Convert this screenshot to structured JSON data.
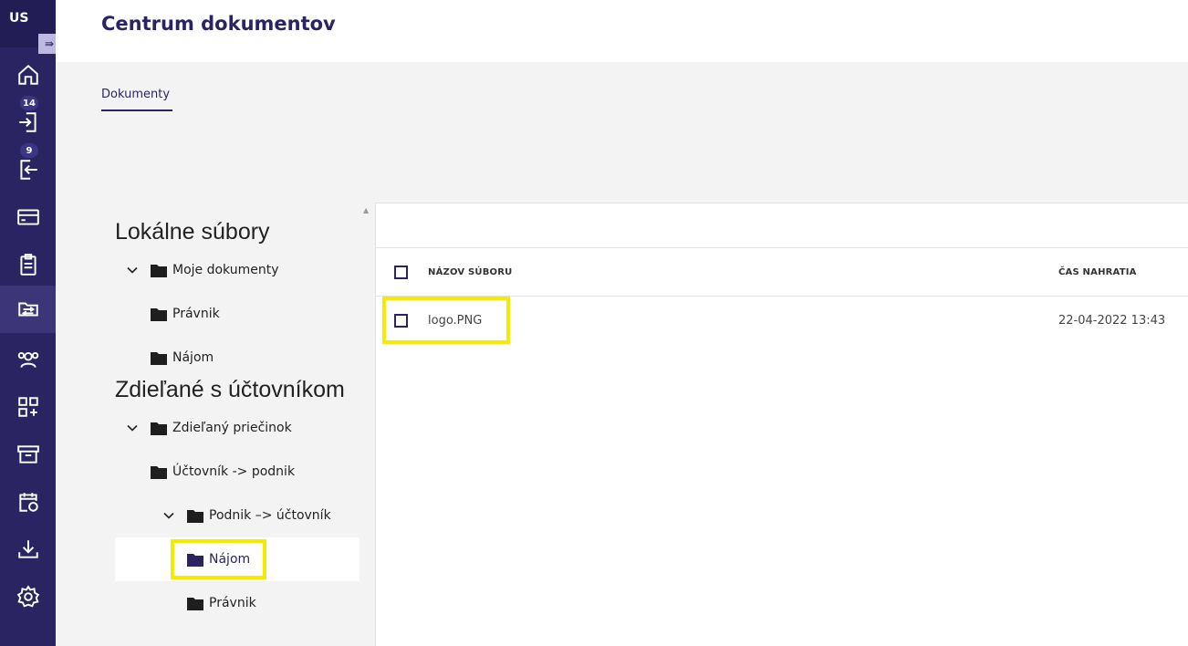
{
  "user": {
    "initials": "US"
  },
  "nav": {
    "inbox_badge": "14",
    "outbox_badge": "9"
  },
  "header": {
    "title": "Centrum dokumentov"
  },
  "tabs": [
    {
      "label": "Dokumenty"
    }
  ],
  "tree": {
    "local_title": "Lokálne súbory",
    "local_items": [
      "Moje dokumenty",
      "Právnik",
      "Nájom"
    ],
    "shared_title": "Zdieľané s účtovníkom",
    "shared_items": [
      "Zdieľaný priečinok",
      "Účtovník -> podnik",
      "Podnik –> účtovník",
      "Nájom",
      "Právnik"
    ]
  },
  "table": {
    "columns": [
      "NÁZOV SÚBORU",
      "ČAS NAHRATIA"
    ],
    "rows": [
      {
        "name": "logo.PNG",
        "uploaded": "22-04-2022 13:43"
      }
    ]
  },
  "colors": {
    "brand": "#2a2562",
    "highlight": "#f7ea00"
  }
}
